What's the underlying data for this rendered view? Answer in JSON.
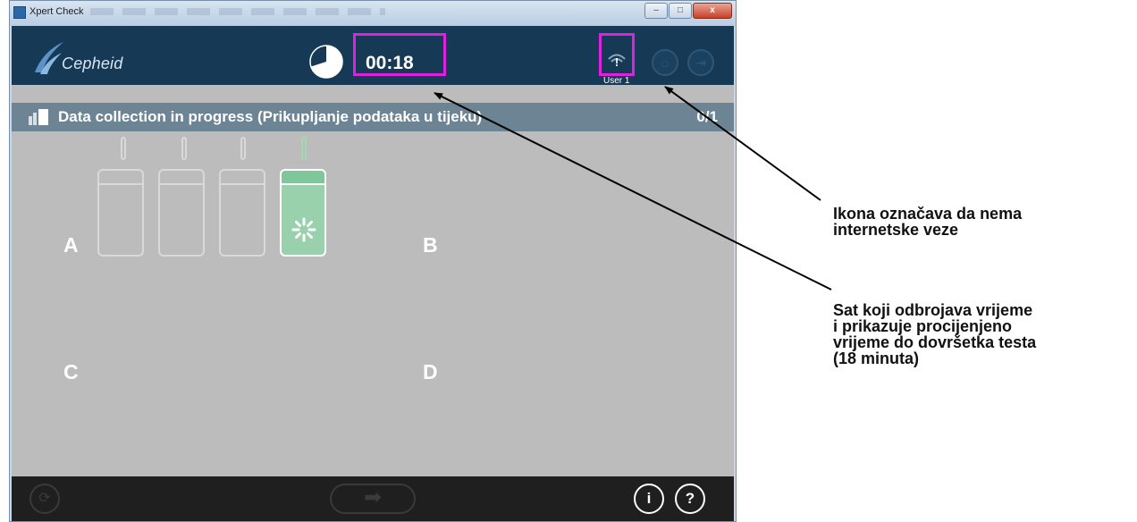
{
  "window": {
    "title": "Xpert Check",
    "controls": [
      "–",
      "□",
      "x"
    ]
  },
  "header": {
    "logo_text": "Cepheid",
    "timer": "00:18",
    "timer_progress": 0.7,
    "network_status": "!",
    "user_label": "User 1"
  },
  "status": {
    "text": "Data collection in progress (Prikupljanje podataka u tijeku)",
    "count": "0/1"
  },
  "modules": {
    "a_label": "A",
    "b_label": "B",
    "c_label": "C",
    "d_label": "D",
    "active_slot_index": 3,
    "slot_count": 4
  },
  "footer": {
    "info_label": "i",
    "help_label": "?"
  },
  "annotations": {
    "network_note": [
      "Ikona označava da nema",
      "internetske veze"
    ],
    "clock_note": [
      "Sat koji odbrojava vrijeme",
      "i prikazuje procijenjeno",
      "vrijeme do dovršetka testa",
      "(18 minuta)"
    ]
  },
  "colors": {
    "header_bg": "#163a55",
    "status_bar": "#6c8493",
    "content_bg": "#bcbcbc",
    "active_module": "#9ad1ad",
    "highlight": "#e020e0"
  },
  "icons": {
    "timer": "timer-pie-icon",
    "network": "no-network-icon",
    "home": "home-icon",
    "logout": "logout-icon",
    "status": "cartridge-status-icon",
    "spinner": "spinner-icon",
    "refresh": "refresh-icon",
    "next": "arrow-right-icon",
    "info": "info-icon",
    "help": "help-icon"
  }
}
